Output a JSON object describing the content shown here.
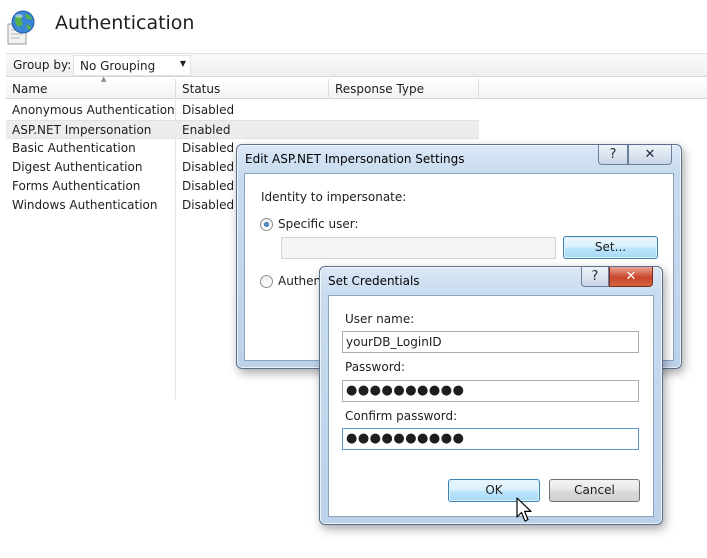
{
  "page": {
    "title": "Authentication",
    "icon": "iis-globe-icon"
  },
  "groupbar": {
    "label": "Group by:",
    "selected": "No Grouping"
  },
  "list": {
    "columns": [
      "Name",
      "Status",
      "Response Type"
    ],
    "rows": [
      {
        "name": "Anonymous Authentication",
        "status": "Disabled",
        "response": ""
      },
      {
        "name": "ASP.NET Impersonation",
        "status": "Enabled",
        "response": ""
      },
      {
        "name": "Basic Authentication",
        "status": "Disabled",
        "response": ""
      },
      {
        "name": "Digest Authentication",
        "status": "Disabled",
        "response": ""
      },
      {
        "name": "Forms Authentication",
        "status": "Disabled",
        "response": ""
      },
      {
        "name": "Windows Authentication",
        "status": "Disabled",
        "response": ""
      }
    ],
    "selected_row": "ASP.NET Impersonation"
  },
  "impersonation_dialog": {
    "title": "Edit ASP.NET Impersonation Settings",
    "identity_label": "Identity to impersonate:",
    "specific_user_label": "Specific user:",
    "specific_user_value": "",
    "set_button": "Set...",
    "authenticated_label_partial": "Authent",
    "help_glyph": "?",
    "close_glyph": "✕"
  },
  "credentials_dialog": {
    "title": "Set Credentials",
    "username_label": "User name:",
    "username_value": "yourDB_LoginID",
    "password_label": "Password:",
    "password_value": "●●●●●●●●●●",
    "confirm_label": "Confirm password:",
    "confirm_value": "●●●●●●●●●●",
    "ok_button": "OK",
    "cancel_button": "Cancel",
    "help_glyph": "?",
    "close_glyph": "✕"
  },
  "colors": {
    "selected_row": "#ececec",
    "dialog_frame": "#c8dbef",
    "close_button": "#c9462c",
    "focused_button": "#bee6fd"
  }
}
